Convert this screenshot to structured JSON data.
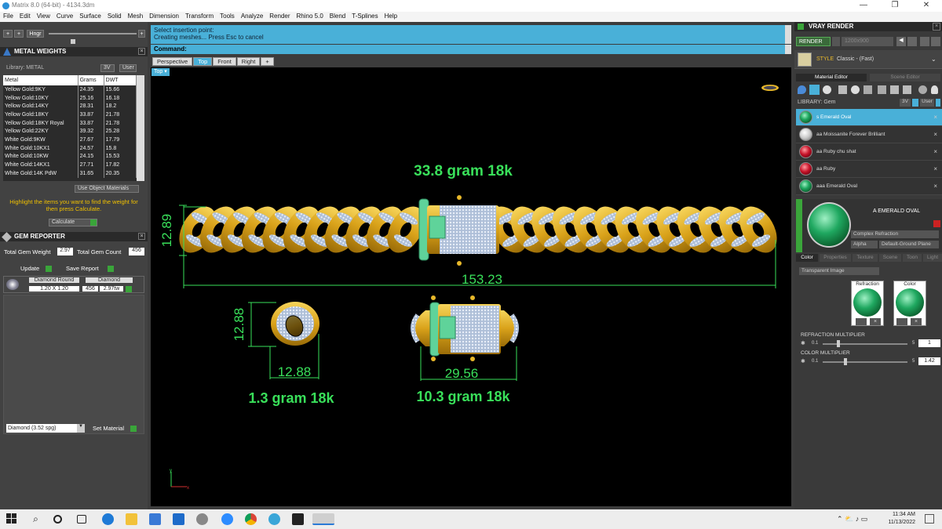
{
  "window": {
    "title": "Matrix 8.0 (64-bit) - 4134.3dm",
    "minimize": "—",
    "maximize": "❐",
    "close": "✕"
  },
  "menu": [
    "File",
    "Edit",
    "View",
    "Curve",
    "Surface",
    "Solid",
    "Mesh",
    "Dimension",
    "Transform",
    "Tools",
    "Analyze",
    "Render",
    "Rhino 5.0",
    "Blend",
    "T-Splines",
    "Help"
  ],
  "left_toolbar": {
    "hinge_label": "Hngr"
  },
  "metal_weights": {
    "title": "METAL WEIGHTS",
    "library_label": "Library: METAL",
    "tag_3v": "3V",
    "tag_user": "User",
    "columns": [
      "Metal",
      "Grams",
      "DWT"
    ],
    "rows": [
      [
        "Yellow Gold:9KY",
        "24.35",
        "15.66"
      ],
      [
        "Yellow Gold:10KY",
        "25.16",
        "16.18"
      ],
      [
        "Yellow Gold:14KY",
        "28.31",
        "18.2"
      ],
      [
        "Yellow Gold:18KY",
        "33.87",
        "21.78"
      ],
      [
        "Yellow Gold:18KY Royal",
        "33.87",
        "21.78"
      ],
      [
        "Yellow Gold:22KY",
        "39.32",
        "25.28"
      ],
      [
        "White Gold:9KW",
        "27.67",
        "17.79"
      ],
      [
        "White Gold:10KX1",
        "24.57",
        "15.8"
      ],
      [
        "White Gold:10KW",
        "24.15",
        "15.53"
      ],
      [
        "White Gold:14KX1",
        "27.71",
        "17.82"
      ],
      [
        "White Gold:14K PdW",
        "31.65",
        "20.35"
      ]
    ],
    "use_object_materials": "Use Object Materials",
    "hint": "Highlight the items you want to find the weight for then press Calculate.",
    "calculate": "Calculate"
  },
  "gem_reporter": {
    "title": "GEM REPORTER",
    "total_weight_label": "Total Gem Weight",
    "total_weight_value": "2.97",
    "total_count_label": "Total Gem Count",
    "total_count_value": "456",
    "update": "Update",
    "save_report": "Save Report",
    "gem_shape": "Diamond Round",
    "gem_material": "Diamond",
    "gem_size": "1.20 X 1.20",
    "gem_count": "456",
    "gem_weight": "2.97tw",
    "material_select": "Diamond    (3.52 spg)",
    "set_material": "Set Material"
  },
  "command": {
    "line1": "Select insertion point:",
    "line2": "Creating meshes... Press Esc to cancel",
    "label": "Command:"
  },
  "viewport_tabs": [
    "Perspective",
    "Top",
    "Front",
    "Right"
  ],
  "viewport_tab_add": "+",
  "viewport_label": "Top",
  "drawing": {
    "chain_weight": "33.8 gram 18k",
    "chain_height": "12.89",
    "chain_length": "153.23",
    "ring_height": "12.88",
    "ring_width": "12.88",
    "ring_weight": "1.3 gram 18k",
    "clasp_width": "29.56",
    "clasp_weight": "10.3 gram 18k",
    "axis_y": "y",
    "axis_x": "x"
  },
  "vray": {
    "title": "VRAY RENDER",
    "render": "RENDER",
    "resolution": "1200x900",
    "style_label": "STYLE",
    "style_value": "Classic - (Fast)",
    "tab_material_editor": "Material Editor",
    "tab_scene_editor": "Scene Editor",
    "library_label": "LIBRARY: Gem",
    "tag_3v": "3V",
    "tag_user": "User",
    "materials": [
      {
        "name": "s Emerald Oval",
        "type": "gem",
        "selected": true
      },
      {
        "name": "aa Moissanite Forever Brilliant",
        "type": "wgem",
        "selected": false
      },
      {
        "name": "aa Ruby chu shat",
        "type": "ruby",
        "selected": false
      },
      {
        "name": "aa Ruby",
        "type": "ruby",
        "selected": false
      },
      {
        "name": "aaa Emerald Oval",
        "type": "gem",
        "selected": false
      }
    ],
    "preview_name": "A EMERALD OVAL",
    "complex_refraction": "Complex Refraction",
    "alpha_label": "Alpha",
    "ground_plane": "Default-Ground Plane",
    "sub_tabs": [
      "Color",
      "Properties",
      "Texture",
      "Scene",
      "Toon",
      "Light"
    ],
    "transparent_image": "Transparent Image",
    "refraction_label": "Refraction",
    "color_label": "Color",
    "refraction_multiplier_label": "REFRACTION MULTIPLIER",
    "refraction_min": "0.1",
    "refraction_max": "5",
    "refraction_value": "1",
    "color_multiplier_label": "COLOR MULTIPLIER",
    "color_min": "0.1",
    "color_max": "5",
    "color_value": "1.42"
  },
  "taskbar": {
    "time": "11:34 AM",
    "date": "11/13/2022"
  },
  "colors": {
    "accent_blue": "#49b0d8",
    "dimension_green": "#39e05a",
    "gold": "#e8b82a"
  }
}
